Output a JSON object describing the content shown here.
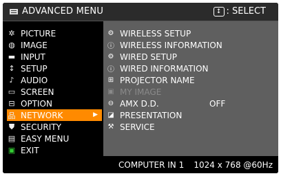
{
  "header": {
    "title": "ADVANCED MENU",
    "select_key": "↕",
    "select_label": ": SELECT"
  },
  "left_menu": [
    {
      "label": "PICTURE",
      "icon": "picture-icon"
    },
    {
      "label": "IMAGE",
      "icon": "image-icon"
    },
    {
      "label": "INPUT",
      "icon": "input-icon"
    },
    {
      "label": "SETUP",
      "icon": "setup-icon"
    },
    {
      "label": "AUDIO",
      "icon": "audio-icon"
    },
    {
      "label": "SCREEN",
      "icon": "screen-icon"
    },
    {
      "label": "OPTION",
      "icon": "option-icon"
    },
    {
      "label": "NETWORK",
      "icon": "network-icon",
      "selected": true
    },
    {
      "label": "SECURITY",
      "icon": "security-icon"
    },
    {
      "label": "EASY MENU",
      "icon": "easy-menu-icon"
    },
    {
      "label": "EXIT",
      "icon": "exit-icon"
    }
  ],
  "network_submenu": [
    {
      "label": "WIRELESS SETUP",
      "icon": "wireless-setup-icon"
    },
    {
      "label": "WIRELESS INFORMATION",
      "icon": "wireless-information-icon"
    },
    {
      "label": "WIRED SETUP",
      "icon": "wired-setup-icon"
    },
    {
      "label": "WIRED INFORMATION",
      "icon": "wired-information-icon"
    },
    {
      "label": "PROJECTOR NAME",
      "icon": "projector-name-icon"
    },
    {
      "label": "MY IMAGE",
      "icon": "my-image-icon",
      "disabled": true
    },
    {
      "label": "AMX D.D.",
      "icon": "amx-icon",
      "value": "OFF"
    },
    {
      "label": "PRESENTATION",
      "icon": "presentation-icon"
    },
    {
      "label": "SERVICE",
      "icon": "service-icon"
    }
  ],
  "footer": {
    "source": "COMPUTER IN 1",
    "resolution": "1024 x 768 @60Hz"
  },
  "colors": {
    "selected": "#ff8a00",
    "submenu_bg": "#5f5f5f",
    "panel_bg": "#000000",
    "disabled_text": "#8a8a8a"
  }
}
